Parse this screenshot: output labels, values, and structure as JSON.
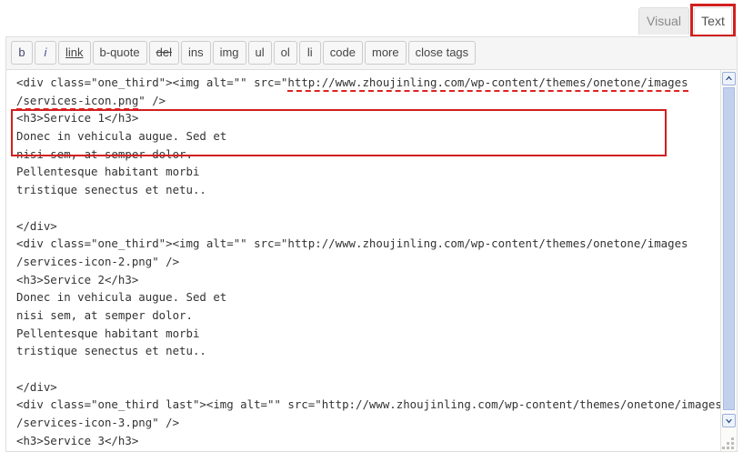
{
  "tabs": {
    "visual_label": "Visual",
    "text_label": "Text",
    "active": "Text",
    "highlight_color": "#d21f1f"
  },
  "toolbar": {
    "buttons": [
      {
        "label": "b",
        "style": "b"
      },
      {
        "label": "i",
        "style": "em"
      },
      {
        "label": "link",
        "style": "u"
      },
      {
        "label": "b-quote",
        "style": ""
      },
      {
        "label": "del",
        "style": "s"
      },
      {
        "label": "ins",
        "style": ""
      },
      {
        "label": "img",
        "style": ""
      },
      {
        "label": "ul",
        "style": ""
      },
      {
        "label": "ol",
        "style": ""
      },
      {
        "label": "li",
        "style": ""
      },
      {
        "label": "code",
        "style": ""
      },
      {
        "label": "more",
        "style": ""
      },
      {
        "label": "close tags",
        "style": ""
      }
    ]
  },
  "editor": {
    "mode": "Text",
    "lines": [
      "<div class=\"one_third\"><img alt=\"\" src=\"http://www.zhoujinling.com/wp-content/themes/onetone/images",
      "/services-icon.png\" />",
      "<h3>Service 1</h3>",
      "Donec in vehicula augue. Sed et",
      "nisi sem, at semper dolor.",
      "Pellentesque habitant morbi",
      "tristique senectus et netu..",
      "",
      "</div>",
      "<div class=\"one_third\"><img alt=\"\" src=\"http://www.zhoujinling.com/wp-content/themes/onetone/images",
      "/services-icon-2.png\" />",
      "<h3>Service 2</h3>",
      "Donec in vehicula augue. Sed et",
      "nisi sem, at semper dolor.",
      "Pellentesque habitant morbi",
      "tristique senectus et netu..",
      "",
      "</div>",
      "<div class=\"one_third last\"><img alt=\"\" src=\"http://www.zhoujinling.com/wp-content/themes/onetone/images",
      "/services-icon-3.png\" />",
      "<h3>Service 3</h3>"
    ],
    "annotated_line_1_prefix": "<div class=\"one_third\"><img alt=\"\" src=\"",
    "annotated_line_1_url": "http://www.zhoujinling.com/wp-content/themes/onetone/images",
    "annotated_line_2_url": "/services-icon.png",
    "annotated_line_2_suffix": "\" />",
    "annotation_color": "#e02020"
  },
  "scrollbar": {
    "up_arrow": "chevron-up-icon",
    "down_arrow": "chevron-down-icon",
    "thumb_position": "top"
  },
  "resize": {
    "grip": "resize-grip-icon"
  }
}
